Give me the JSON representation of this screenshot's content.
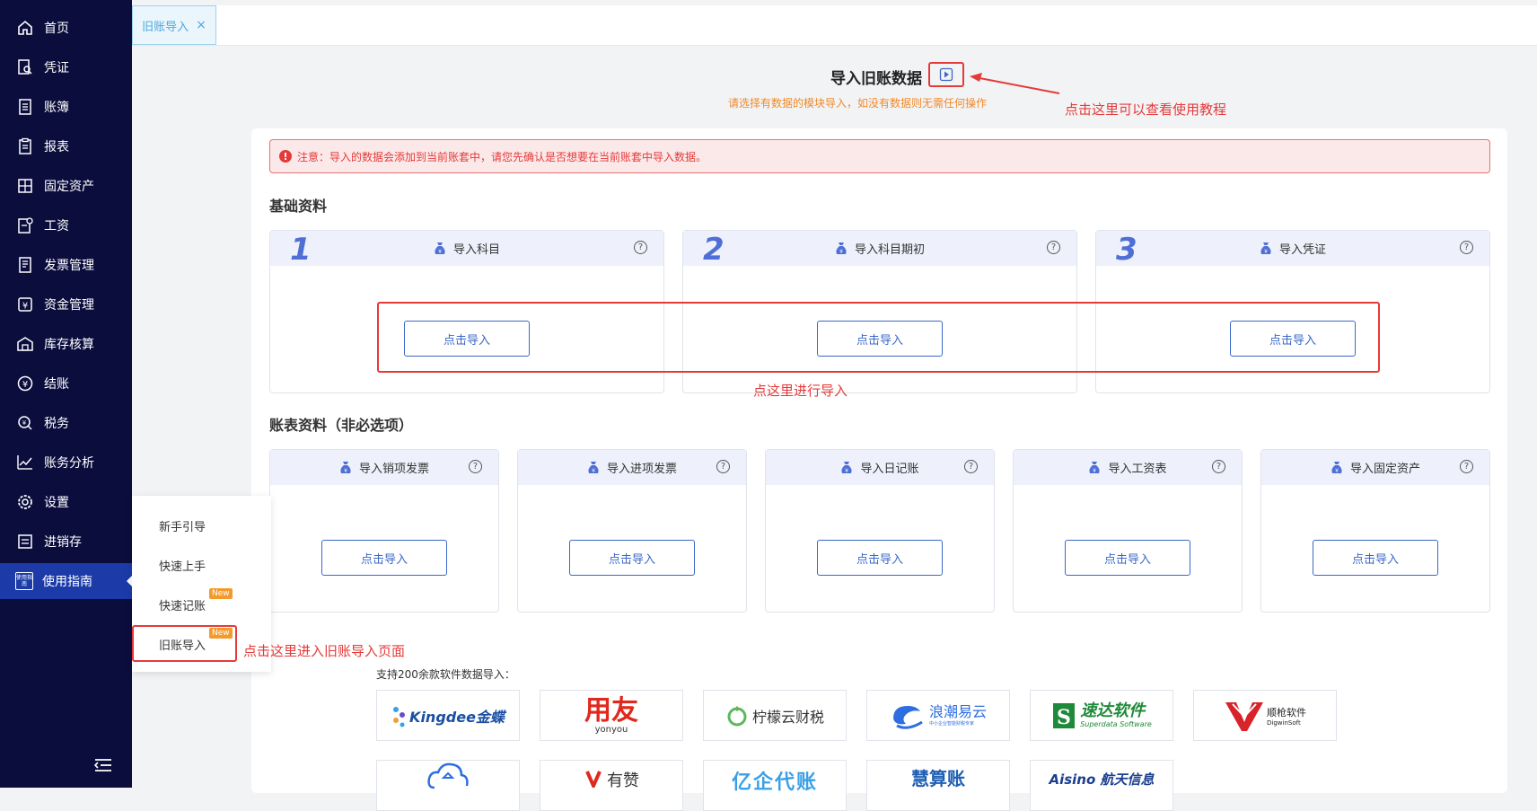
{
  "sidebar": {
    "items": [
      {
        "label": "首页",
        "icon": "home-icon"
      },
      {
        "label": "凭证",
        "icon": "voucher-search-icon"
      },
      {
        "label": "账簿",
        "icon": "ledger-icon"
      },
      {
        "label": "报表",
        "icon": "report-clipboard-icon"
      },
      {
        "label": "固定资产",
        "icon": "fixed-asset-icon"
      },
      {
        "label": "工资",
        "icon": "salary-icon"
      },
      {
        "label": "发票管理",
        "icon": "invoice-icon"
      },
      {
        "label": "资金管理",
        "icon": "yuan-icon"
      },
      {
        "label": "库存核算",
        "icon": "warehouse-icon"
      },
      {
        "label": "结账",
        "icon": "settle-icon"
      },
      {
        "label": "税务",
        "icon": "tax-icon"
      },
      {
        "label": "账务分析",
        "icon": "chart-line-icon"
      },
      {
        "label": "设置",
        "icon": "gear-icon"
      },
      {
        "label": "进销存",
        "icon": "inventory-icon"
      },
      {
        "label": "使用指南",
        "icon": "guide-icon"
      }
    ],
    "guide_icon_text": "使用指南"
  },
  "submenu": {
    "items": [
      {
        "label": "新手引导",
        "badge": ""
      },
      {
        "label": "快速上手",
        "badge": ""
      },
      {
        "label": "快速记账",
        "badge": "New"
      },
      {
        "label": "旧账导入",
        "badge": "New"
      }
    ]
  },
  "tab": {
    "label": "旧账导入",
    "close": "×"
  },
  "header": {
    "title": "导入旧账数据",
    "subtitle": "请选择有数据的模块导入，如没有数据则无需任何操作"
  },
  "callouts": {
    "tutorial": "点击这里可以查看使用教程",
    "import_here": "点这里进行导入",
    "open_page": "点击这里进入旧账导入页面"
  },
  "notice": {
    "text": "注意：导入的数据会添加到当前账套中，请您先确认是否想要在当前账套中导入数据。"
  },
  "basic": {
    "title": "基础资料",
    "cards": [
      {
        "num": "1",
        "label": "导入科目",
        "button": "点击导入"
      },
      {
        "num": "2",
        "label": "导入科目期初",
        "button": "点击导入"
      },
      {
        "num": "3",
        "label": "导入凭证",
        "button": "点击导入"
      }
    ]
  },
  "optional": {
    "title": "账表资料（非必选项）",
    "cards": [
      {
        "label": "导入销项发票",
        "button": "点击导入"
      },
      {
        "label": "导入进项发票",
        "button": "点击导入"
      },
      {
        "label": "导入日记账",
        "button": "点击导入"
      },
      {
        "label": "导入工资表",
        "button": "点击导入"
      },
      {
        "label": "导入固定资产",
        "button": "点击导入"
      }
    ]
  },
  "support": {
    "text": "支持200余款软件数据导入：",
    "logos": [
      {
        "name": "Kingdee金蝶",
        "sub": ""
      },
      {
        "name": "用友",
        "sub": "yonyou"
      },
      {
        "name": "柠檬云财税",
        "sub": ""
      },
      {
        "name": "浪潮易云",
        "sub": "中小企业智能财税专家"
      },
      {
        "name": "速达软件",
        "sub": "Superdata Software"
      },
      {
        "name": "顺枪软件",
        "sub": "DigwinSoft"
      },
      {
        "name": "",
        "sub": ""
      },
      {
        "name": "有赞",
        "sub": ""
      },
      {
        "name": "亿企代账",
        "sub": ""
      },
      {
        "name": "慧算账",
        "sub": ""
      },
      {
        "name": "Aisino 航天信息",
        "sub": ""
      }
    ]
  },
  "colors": {
    "sidebar_bg": "#0b0e3d",
    "accent": "#3a68c8",
    "alert": "#e53a3a",
    "subtitle": "#f08a2a",
    "tab_text": "#4da6de"
  }
}
